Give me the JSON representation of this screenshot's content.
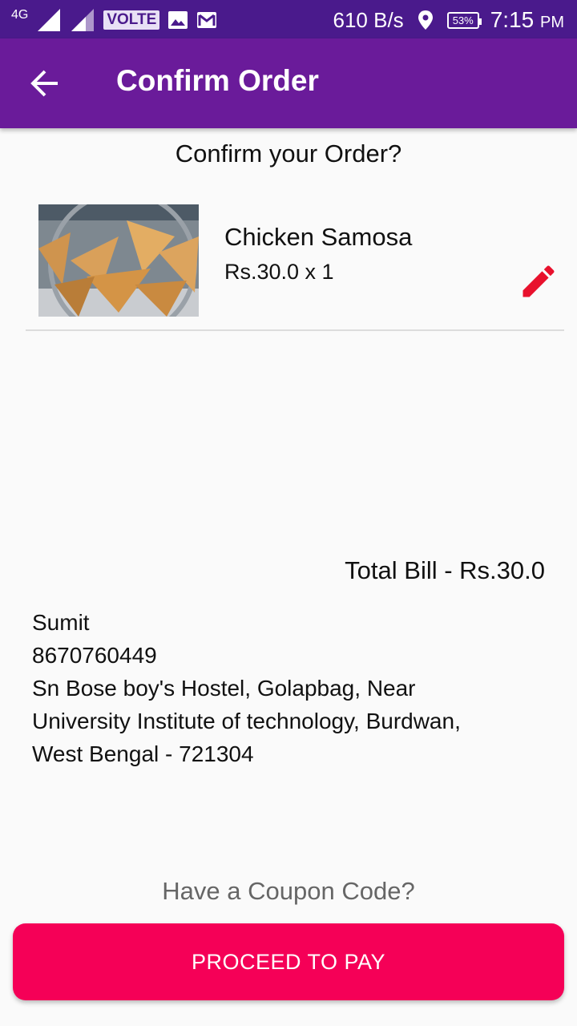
{
  "status_bar": {
    "network_type": "4G",
    "sim1_index": "1",
    "sim2_index": "2",
    "volte": "VOLTE",
    "data_speed": "610 B/s",
    "battery": "53%",
    "time": "7:15",
    "ampm": "PM"
  },
  "app_bar": {
    "title": "Confirm Order"
  },
  "heading": "Confirm your Order?",
  "order_item": {
    "name": "Chicken Samosa",
    "price_qty": "Rs.30.0 x 1"
  },
  "total_bill": "Total Bill - Rs.30.0",
  "customer": {
    "name": "Sumit",
    "phone": "8670760449",
    "address_line1": "Sn Bose boy's Hostel, Golapbag, Near",
    "address_line2": "University Institute of technology, Burdwan,",
    "address_line3": "West Bengal - 721304"
  },
  "coupon_link": "Have a Coupon Code?",
  "pay_button": "PROCEED TO PAY",
  "colors": {
    "status_bar": "#4a1a8c",
    "app_bar": "#6a1b9a",
    "accent": "#f50057",
    "edit_icon": "#e8112d"
  },
  "icons": [
    "back-arrow-icon",
    "edit-pencil-icon",
    "signal-icon",
    "gallery-icon",
    "gmail-icon",
    "location-icon",
    "battery-icon"
  ]
}
